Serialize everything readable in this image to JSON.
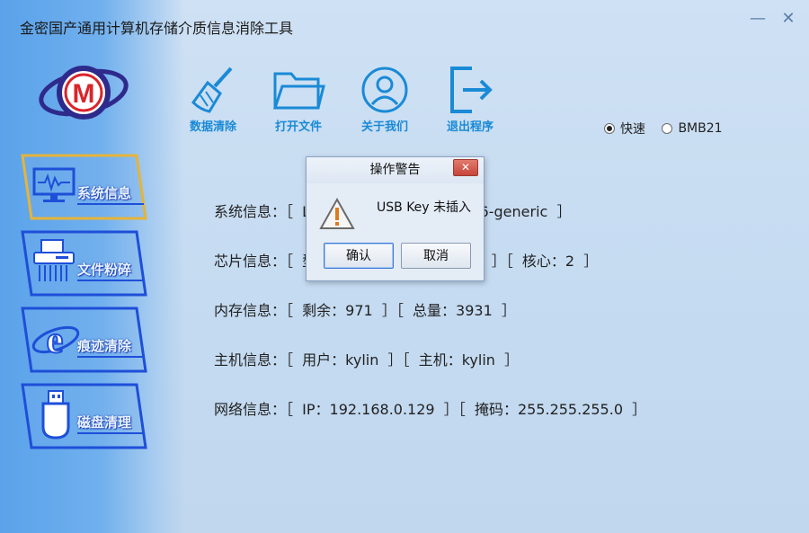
{
  "window": {
    "title": "金密国产通用计算机存储介质信息消除工具",
    "minimize_glyph": "—",
    "close_glyph": "✕"
  },
  "sidebar": {
    "items": [
      {
        "label": "系统信息",
        "icon": "monitor-icon",
        "active": true
      },
      {
        "label": "文件粉碎",
        "icon": "shredder-icon",
        "active": false
      },
      {
        "label": "痕迹清除",
        "icon": "ie-icon",
        "active": false
      },
      {
        "label": "磁盘清理",
        "icon": "usb-icon",
        "active": false
      }
    ]
  },
  "toolbar": {
    "items": [
      {
        "label": "数据清除",
        "icon": "broom-icon"
      },
      {
        "label": "打开文件",
        "icon": "folder-icon"
      },
      {
        "label": "关于我们",
        "icon": "user-icon"
      },
      {
        "label": "退出程序",
        "icon": "exit-icon"
      }
    ]
  },
  "mode": {
    "options": [
      {
        "label": "快速",
        "selected": true
      },
      {
        "label": "BMB21",
        "selected": false
      }
    ]
  },
  "info": {
    "system": "系统信息：［  Linux  ］［  系统：kylin.x86-generic  ］",
    "chip": "芯片信息：［  型号：Intel Xeon E5-2420  ］［  核心：2  ］",
    "memory": "内存信息：［  剩余：971  ］［  总量：3931  ］",
    "host": "主机信息：［  用户：kylin  ］［  主机：kylin  ］",
    "network": "网络信息：［  IP：192.168.0.129  ］［  掩码：255.255.255.0  ］"
  },
  "dialog": {
    "title": "操作警告",
    "message": "USB Key 未插入",
    "ok_label": "确认",
    "cancel_label": "取消",
    "close_glyph": "✕"
  },
  "colors": {
    "accent": "#1a8ad6",
    "nav_active_border": "#e5b43a",
    "nav_border": "#1e4fd8",
    "logo_red": "#d9252b",
    "logo_purple": "#2e2a8c"
  }
}
